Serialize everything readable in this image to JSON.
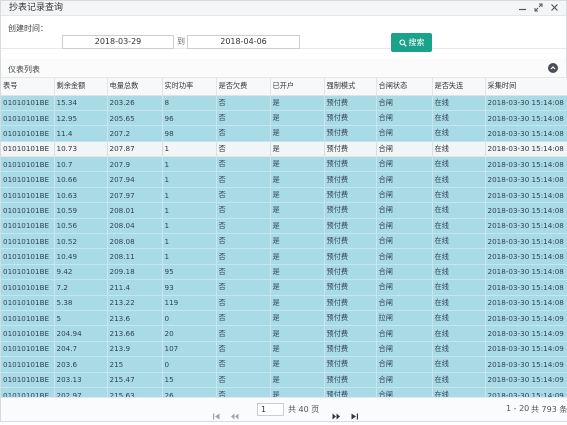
{
  "window": {
    "title": "抄表记录查询"
  },
  "filter": {
    "label": "创建时间：",
    "start_date": "2018-03-29",
    "to_label": "到",
    "end_date": "2018-04-06",
    "search_label": "搜索"
  },
  "panel": {
    "title": "仪表列表"
  },
  "table": {
    "columns": [
      "表号",
      "剩余金额",
      "电量总数",
      "实时功率",
      "是否欠费",
      "已开户",
      "强制模式",
      "合闸状态",
      "是否失连",
      "采集时间"
    ],
    "rows": [
      [
        "01010101BE",
        "15.34",
        "203.26",
        "8",
        "否",
        "是",
        "预付费",
        "合闸",
        "在线",
        "2018-03-30 15:14:08"
      ],
      [
        "01010101BE",
        "12.95",
        "205.65",
        "96",
        "否",
        "是",
        "预付费",
        "合闸",
        "在线",
        "2018-03-30 15:14:08"
      ],
      [
        "01010101BE",
        "11.4",
        "207.2",
        "98",
        "否",
        "是",
        "预付费",
        "合闸",
        "在线",
        "2018-03-30 15:14:08"
      ],
      [
        "01010101BE",
        "10.73",
        "207.87",
        "1",
        "否",
        "是",
        "预付费",
        "合闸",
        "在线",
        "2018-03-30 15:14:08"
      ],
      [
        "01010101BE",
        "10.7",
        "207.9",
        "1",
        "否",
        "是",
        "预付费",
        "合闸",
        "在线",
        "2018-03-30 15:14:08"
      ],
      [
        "01010101BE",
        "10.66",
        "207.94",
        "1",
        "否",
        "是",
        "预付费",
        "合闸",
        "在线",
        "2018-03-30 15:14:08"
      ],
      [
        "01010101BE",
        "10.63",
        "207.97",
        "1",
        "否",
        "是",
        "预付费",
        "合闸",
        "在线",
        "2018-03-30 15:14:08"
      ],
      [
        "01010101BE",
        "10.59",
        "208.01",
        "1",
        "否",
        "是",
        "预付费",
        "合闸",
        "在线",
        "2018-03-30 15:14:08"
      ],
      [
        "01010101BE",
        "10.56",
        "208.04",
        "1",
        "否",
        "是",
        "预付费",
        "合闸",
        "在线",
        "2018-03-30 15:14:08"
      ],
      [
        "01010101BE",
        "10.52",
        "208.08",
        "1",
        "否",
        "是",
        "预付费",
        "合闸",
        "在线",
        "2018-03-30 15:14:08"
      ],
      [
        "01010101BE",
        "10.49",
        "208.11",
        "1",
        "否",
        "是",
        "预付费",
        "合闸",
        "在线",
        "2018-03-30 15:14:08"
      ],
      [
        "01010101BE",
        "9.42",
        "209.18",
        "95",
        "否",
        "是",
        "预付费",
        "合闸",
        "在线",
        "2018-03-30 15:14:08"
      ],
      [
        "01010101BE",
        "7.2",
        "211.4",
        "93",
        "否",
        "是",
        "预付费",
        "合闸",
        "在线",
        "2018-03-30 15:14:08"
      ],
      [
        "01010101BE",
        "5.38",
        "213.22",
        "119",
        "否",
        "是",
        "预付费",
        "合闸",
        "在线",
        "2018-03-30 15:14:08"
      ],
      [
        "01010101BE",
        "5",
        "213.6",
        "0",
        "否",
        "是",
        "预付费",
        "拉闸",
        "在线",
        "2018-03-30 15:14:09"
      ],
      [
        "01010101BE",
        "204.94",
        "213.66",
        "20",
        "否",
        "是",
        "预付费",
        "合闸",
        "在线",
        "2018-03-30 15:14:09"
      ],
      [
        "01010101BE",
        "204.7",
        "213.9",
        "107",
        "否",
        "是",
        "预付费",
        "合闸",
        "在线",
        "2018-03-30 15:14:09"
      ],
      [
        "01010101BE",
        "203.6",
        "215",
        "0",
        "否",
        "是",
        "预付费",
        "合闸",
        "在线",
        "2018-03-30 15:14:09"
      ],
      [
        "01010101BE",
        "203.13",
        "215.47",
        "15",
        "否",
        "是",
        "预付费",
        "合闸",
        "在线",
        "2018-03-30 15:14:09"
      ],
      [
        "01010101BE",
        "202.97",
        "215.63",
        "26",
        "否",
        "是",
        "预付费",
        "合闸",
        "在线",
        "2018-03-30 15:14:09"
      ]
    ],
    "highlighted_row_index": 3
  },
  "pager": {
    "current_page": "1",
    "total_pages_text": "共 40 页",
    "range_text": "1 - 20",
    "total_text": "共 793 条"
  },
  "colors": {
    "accent": "#1aa38a",
    "row_selected": "#a9dbe6",
    "row_plain": "#f2f4f5"
  },
  "icons": [
    "minimize-icon",
    "maximize-icon",
    "close-icon",
    "search-icon",
    "collapse-icon",
    "first-page-icon",
    "prev-page-icon",
    "next-page-icon",
    "last-page-icon"
  ]
}
